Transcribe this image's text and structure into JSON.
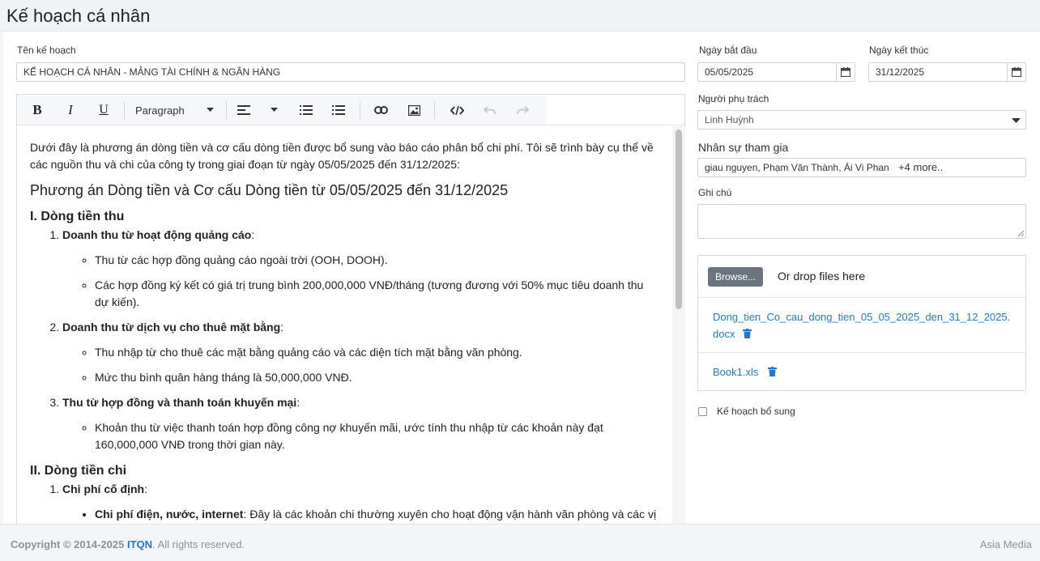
{
  "page": {
    "title": "Kế hoạch cá nhân"
  },
  "form": {
    "plan_name_label": "Tên kế hoạch",
    "plan_name_value": "KẾ HOẠCH CÁ NHÂN - MẢNG TÀI CHÍNH & NGÂN HÀNG",
    "start_label": "Ngày bắt đầu",
    "start_value": "05/05/2025",
    "end_label": "Ngày kết thúc",
    "end_value": "31/12/2025",
    "owner_label": "Người phụ trách",
    "owner_value": "Linh Huỳnh",
    "members_label": "Nhân sự tham gia",
    "members_value": "giau nguyen, Phạm Văn Thành, Ái Vi Phan",
    "members_more": "+4 more..",
    "notes_label": "Ghi chú",
    "notes_value": "",
    "supplement_label": "Kế hoạch bổ sung"
  },
  "toolbar": {
    "bold": "B",
    "italic": "I",
    "underline": "U",
    "block_format": "Paragraph"
  },
  "doc": {
    "intro": "Dưới đây là phương án dòng tiền và cơ cấu dòng tiền được bổ sung vào báo cáo phân bổ chi phí. Tôi sẽ trình bày cụ thể về các nguồn thu và chi của công ty trong giai đoạn từ ngày 05/05/2025 đến 31/12/2025:",
    "heading": "Phương án Dòng tiền và Cơ cấu Dòng tiền từ 05/05/2025 đến 31/12/2025",
    "sec1_title": "I. Dòng tiền thu",
    "s1_i1_title": "Doanh thu từ hoạt động quảng cáo",
    "s1_i1_b1": "Thu từ các hợp đồng quảng cáo ngoài trời (OOH, DOOH).",
    "s1_i1_b2": "Các hợp đồng ký kết có giá trị trung bình 200,000,000 VNĐ/tháng (tương đương với 50% mục tiêu doanh thu dự kiến).",
    "s1_i2_title": "Doanh thu từ dịch vụ cho thuê mặt bằng",
    "s1_i2_b1": "Thu nhập từ cho thuê các mặt bằng quảng cáo và các diện tích mặt bằng văn phòng.",
    "s1_i2_b2": "Mức thu bình quân hàng tháng là 50,000,000 VNĐ.",
    "s1_i3_title": "Thu từ hợp đồng và thanh toán khuyến mại",
    "s1_i3_b1": "Khoản thu từ việc thanh toán hợp đồng công nợ khuyến mãi, ước tính thu nhập từ các khoản này đạt 160,000,000 VNĐ trong thời gian này.",
    "sec2_title": "II. Dòng tiền chi",
    "s2_i1_title": "Chi phí cố định",
    "s2_i1_b1_bold": "Chi phí điện, nước, internet",
    "s2_i1_b1_text": ": Đây là các khoản chi thường xuyên cho hoạt động vận hành văn phòng và các vị"
  },
  "upload": {
    "browse_label": "Browse...",
    "drop_text": "Or drop files here",
    "files": [
      {
        "name": "Dong_tien_Co_cau_dong_tien_05_05_2025_den_31_12_2025.docx"
      },
      {
        "name": "Book1.xls"
      }
    ]
  },
  "footer": {
    "copyright_prefix": "Copyright © 2014-2025",
    "brand": "ITQN",
    "rights": ". All rights reserved.",
    "right_text": "Asia Media"
  },
  "colors": {
    "link": "#1e79d6",
    "browse_bg": "#6c757d"
  }
}
